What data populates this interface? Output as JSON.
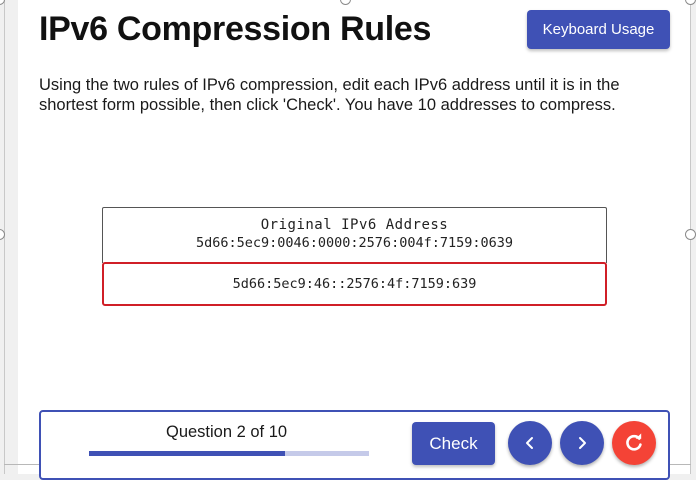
{
  "page": {
    "title": "IPv6 Compression Rules",
    "instructions": "Using the two rules of IPv6 compression, edit each IPv6 address until it is in the shortest form possible, then click 'Check'. You have 10 addresses to compress."
  },
  "toolbar": {
    "keyboard_label": "Keyboard Usage"
  },
  "address": {
    "heading": "Original IPv6 Address",
    "original": "5d66:5ec9:0046:0000:2576:004f:7159:0639",
    "answer_value": "5d66:5ec9:46::2576:4f:7159:639"
  },
  "controls": {
    "question_label": "Question 2 of 10",
    "progress_fraction": 0.7,
    "check_label": "Check",
    "prev_icon": "chevron-left-icon",
    "next_icon": "chevron-right-icon",
    "reset_icon": "refresh-icon"
  },
  "colors": {
    "primary": "#3f51b5",
    "progress_track": "#c5cae9",
    "danger": "#f44336",
    "input_border": "#d01f27"
  }
}
